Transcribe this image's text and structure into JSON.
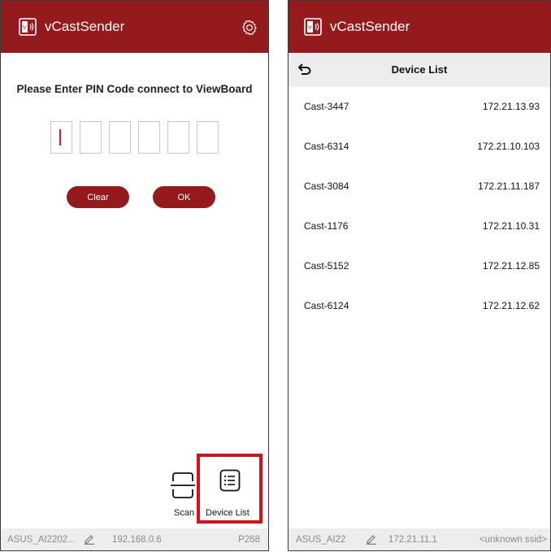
{
  "left": {
    "app_title": "vCastSender",
    "prompt": "Please Enter PIN Code connect to ViewBoard",
    "pin_box_count": 6,
    "clear_label": "Clear",
    "ok_label": "OK",
    "scan_label": "Scan",
    "device_list_label": "Device List",
    "status": {
      "device_name": "ASUS_AI2202...",
      "ip": "192.168.0.6",
      "code": "P268"
    }
  },
  "right": {
    "app_title": "vCastSender",
    "toolbar_title": "Device List",
    "devices": [
      {
        "name": "Cast-3447",
        "ip": "172.21.13.93"
      },
      {
        "name": "Cast-6314",
        "ip": "172.21.10.103"
      },
      {
        "name": "Cast-3084",
        "ip": "172.21.11.187"
      },
      {
        "name": "Cast-1176",
        "ip": "172.21.10.31"
      },
      {
        "name": "Cast-5152",
        "ip": "172.21.12.85"
      },
      {
        "name": "Cast-6124",
        "ip": "172.21.12.62"
      }
    ],
    "status": {
      "device_name": "ASUS_AI22",
      "ip": "172.21.11.1",
      "ssid": "<unknown ssid>"
    }
  },
  "colors": {
    "brand": "#941a1d",
    "highlight": "#d0121a",
    "toolbar_bg": "#ededed"
  },
  "icons": [
    "app-logo-icon",
    "gear-icon",
    "scan-icon",
    "list-icon",
    "back-arrow-icon",
    "pencil-icon"
  ]
}
